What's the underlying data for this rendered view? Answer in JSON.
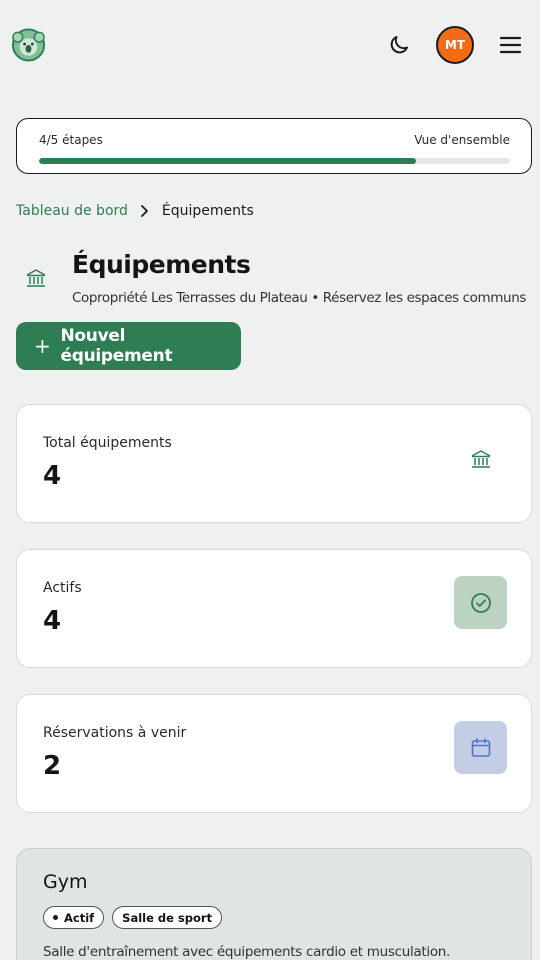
{
  "header": {
    "avatar_initials": "MT",
    "icons": {
      "logo": "koala-logo-icon",
      "theme": "moon-icon",
      "menu": "hamburger-menu-icon"
    }
  },
  "progress": {
    "steps_label": "4/5 étapes",
    "overview_link": "Vue d'ensemble",
    "value": 0.8
  },
  "breadcrumb": {
    "parent": "Tableau de bord",
    "current": "Équipements"
  },
  "page": {
    "title": "Équipements",
    "subtitle": "Copropriété Les Terrasses du Plateau • Réservez les espaces communs",
    "new_button_plus": "+",
    "new_button_label": "Nouvel équipement"
  },
  "stats": [
    {
      "label": "Total équipements",
      "value": "4",
      "icon": "building-icon"
    },
    {
      "label": "Actifs",
      "value": "4",
      "icon": "check-circle-icon"
    },
    {
      "label": "Réservations à venir",
      "value": "2",
      "icon": "calendar-icon"
    }
  ],
  "amenities": [
    {
      "name": "Gym",
      "status": "Actif",
      "category": "Salle de sport",
      "description": "Salle d'entraînement avec équipements cardio et musculation."
    }
  ],
  "colors": {
    "accent": "#2f7d52",
    "avatar": "#f26b16",
    "background": "#eff1f0",
    "active_icon_bg": "#bcd3c3",
    "reservation_icon_bg": "#c3cde6"
  }
}
